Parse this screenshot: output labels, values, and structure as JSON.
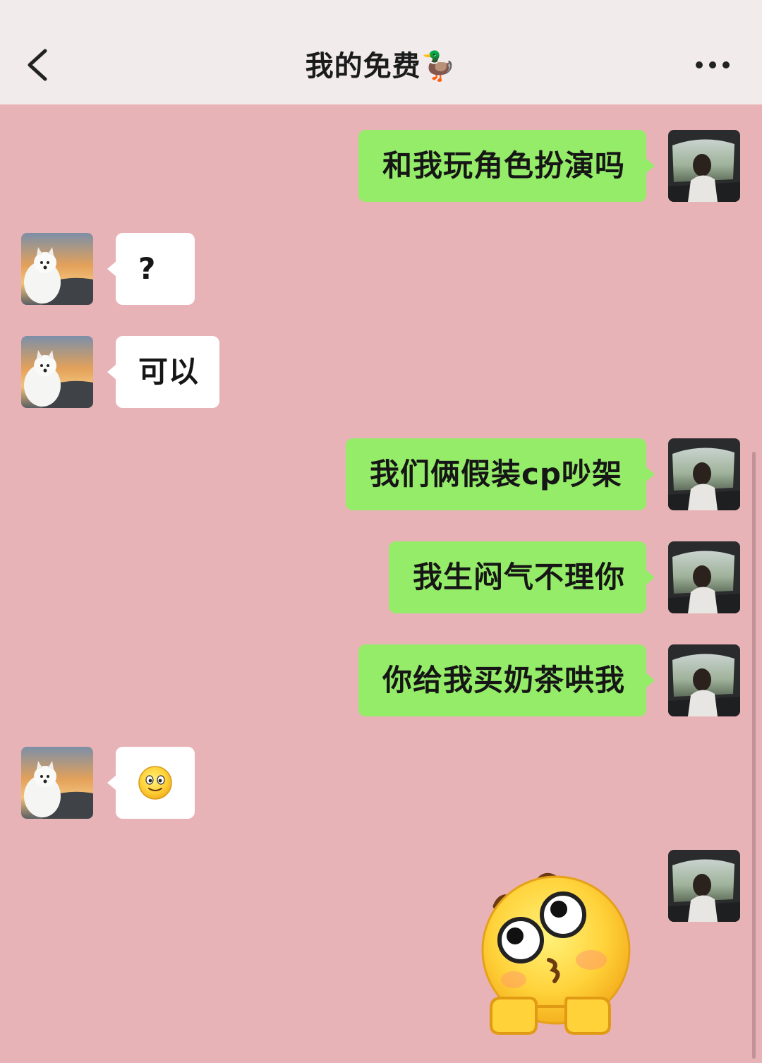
{
  "header": {
    "title": "我的免费🦆",
    "back_icon": "chevron-left-icon",
    "more_icon": "more-dots-icon"
  },
  "messages": [
    {
      "from": "me",
      "text": "和我玩角色扮演吗"
    },
    {
      "from": "other",
      "text": "?"
    },
    {
      "from": "other",
      "text": "可以"
    },
    {
      "from": "me",
      "text": "我们俩假装cp吵架"
    },
    {
      "from": "me",
      "text": "我生闷气不理你"
    },
    {
      "from": "me",
      "text": "你给我买奶茶哄我"
    },
    {
      "from": "other",
      "emoji": "smile-emoji"
    },
    {
      "from": "me",
      "sticker": "pleading-emoji-sticker"
    }
  ],
  "avatars": {
    "me": "girl-in-car-avatar",
    "other": "samoyed-sunset-avatar"
  },
  "colors": {
    "background": "#e8b3b7",
    "nav_background": "#f1ebeb",
    "my_bubble": "#95ec69",
    "other_bubble": "#ffffff"
  }
}
